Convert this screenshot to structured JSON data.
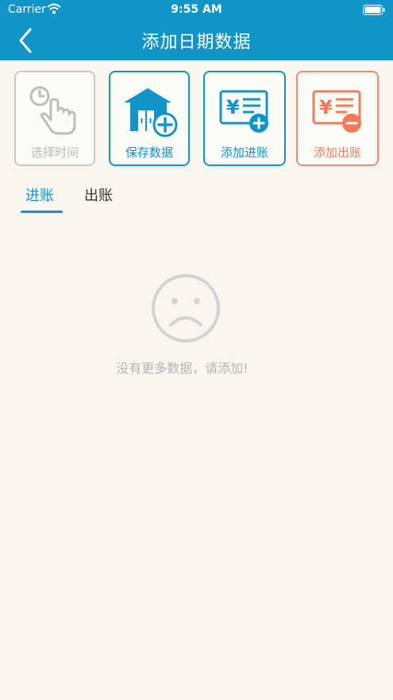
{
  "status_bar": {
    "carrier": "Carrier",
    "time": "9:55 AM"
  },
  "nav": {
    "title": "添加日期数据"
  },
  "actions": [
    {
      "label": "选择时间",
      "icon": "hand-pointer-clock-icon",
      "color": "#b8b8b8"
    },
    {
      "label": "保存数据",
      "icon": "house-plus-icon",
      "color": "#1294c8"
    },
    {
      "label": "添加进账",
      "icon": "yen-bill-plus-icon",
      "color": "#1294c8"
    },
    {
      "label": "添加出账",
      "icon": "yen-bill-minus-icon",
      "color": "#f07a5a"
    }
  ],
  "tabs": [
    {
      "label": "进账",
      "active": true
    },
    {
      "label": "出账",
      "active": false
    }
  ],
  "empty_state": {
    "icon": "sad-face-icon",
    "message": "没有更多数据，请添加!"
  },
  "colors": {
    "accent": "#1294c8",
    "danger": "#f07a5a",
    "background": "#f8f6ee"
  }
}
